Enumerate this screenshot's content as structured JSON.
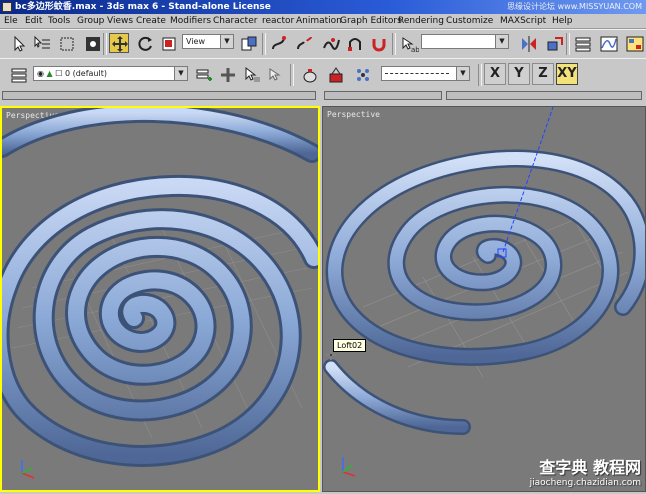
{
  "window": {
    "title": "bc多边形蚊香.max - 3ds max 6 - Stand-alone License",
    "watermark_top": "思缘设计论坛 www.MISSYUAN.COM"
  },
  "menu": [
    "Ele",
    "Edit",
    "Tools",
    "Group",
    "Views",
    "Create",
    "Modifiers",
    "Character",
    "reactor",
    "Animation",
    "Graph Editors",
    "Rendering",
    "Customize",
    "MAXScript",
    "Help"
  ],
  "toolbar_main": {
    "reference_coord": "View",
    "named_selection": ""
  },
  "toolbar_layers": {
    "layer": "0 (default)",
    "line_style": ""
  },
  "axis_constraints": [
    {
      "label": "X",
      "active": false
    },
    {
      "label": "Y",
      "active": false
    },
    {
      "label": "Z",
      "active": false
    },
    {
      "label": "XY",
      "active": true
    }
  ],
  "viewports": [
    {
      "label": "Perspective",
      "active": true
    },
    {
      "label": "Perspective",
      "active": false
    }
  ],
  "tooltip": "Loft02",
  "watermark_bottom": {
    "brand": "查字典 教程网",
    "url": "jiaocheng.chazidian.com"
  },
  "colors": {
    "title_gradient": "#0b2a8a",
    "viewport_bg": "#7a7a7a",
    "active_border": "#ffff00",
    "spiral": "#7f9fd0",
    "axis_active": "#f3e27a"
  }
}
